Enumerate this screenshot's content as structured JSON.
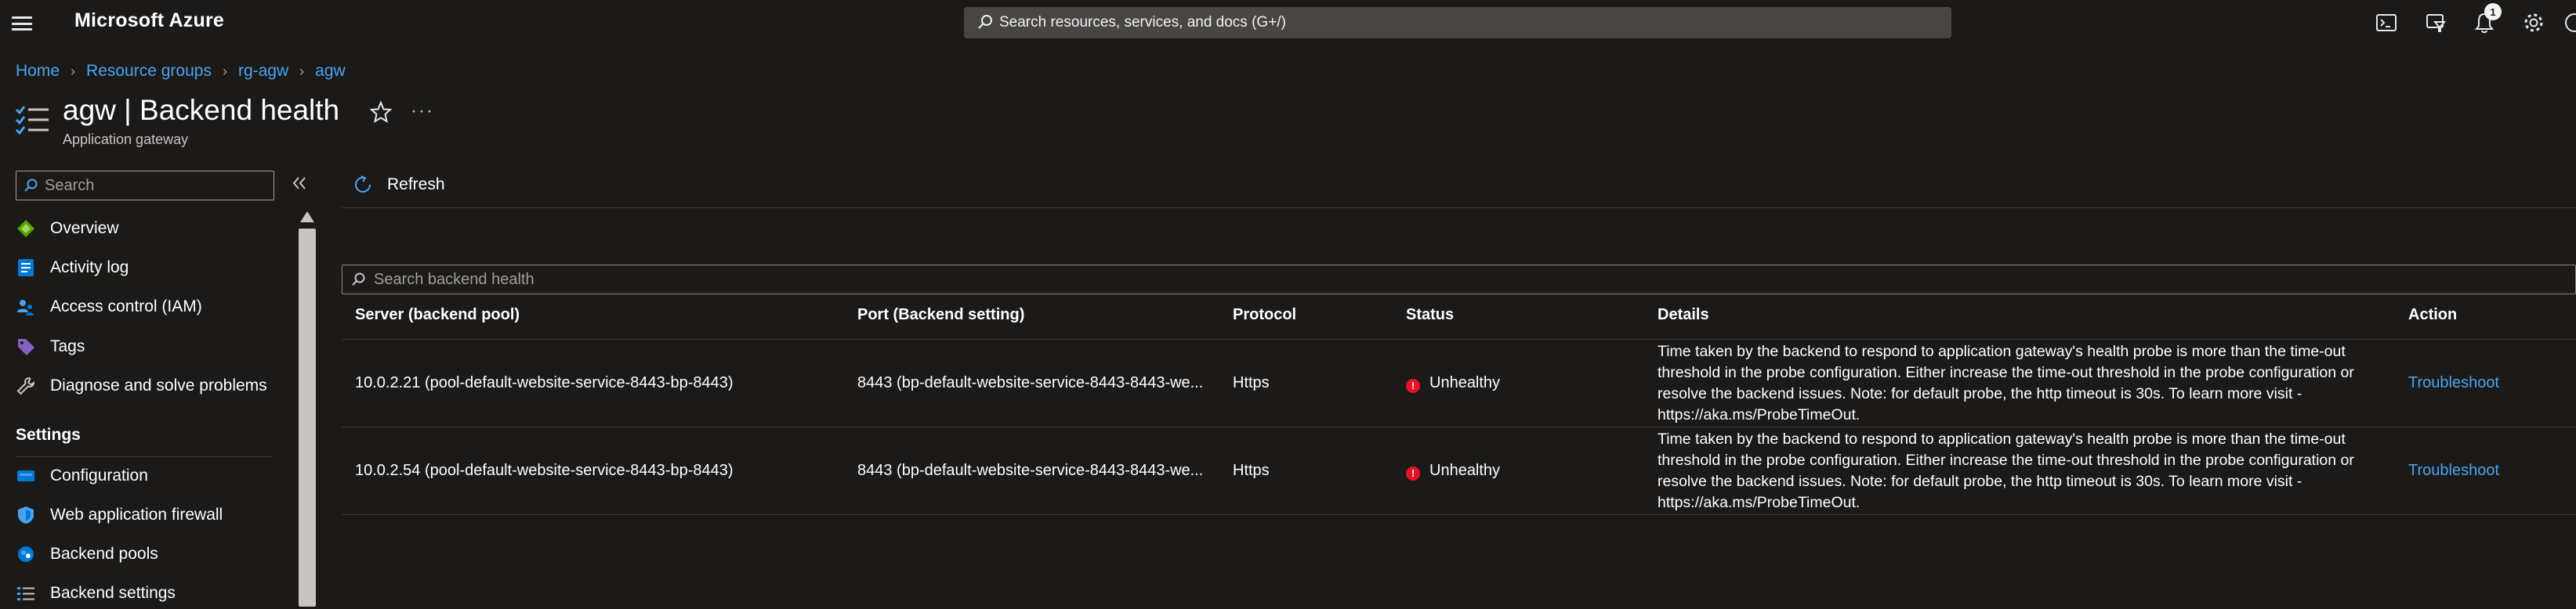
{
  "topbar": {
    "brand": "Microsoft Azure",
    "search_placeholder": "Search resources, services, and docs (G+/)",
    "notification_count": "1",
    "icons": [
      "cloud-shell-icon",
      "directory-filter-icon",
      "notifications-icon",
      "settings-icon"
    ]
  },
  "breadcrumb": [
    "Home",
    "Resource groups",
    "rg-agw",
    "agw"
  ],
  "page": {
    "title": "agw | Backend health",
    "subtitle": "Application gateway"
  },
  "nav": {
    "search_placeholder": "Search",
    "items": [
      {
        "label": "Overview",
        "icon": "overview-icon"
      },
      {
        "label": "Activity log",
        "icon": "activity-log-icon"
      },
      {
        "label": "Access control (IAM)",
        "icon": "iam-icon"
      },
      {
        "label": "Tags",
        "icon": "tag-icon"
      },
      {
        "label": "Diagnose and solve problems",
        "icon": "wrench-icon"
      }
    ],
    "settings_header": "Settings",
    "settings_items": [
      {
        "label": "Configuration",
        "icon": "configuration-icon"
      },
      {
        "label": "Web application firewall",
        "icon": "shield-icon"
      },
      {
        "label": "Backend pools",
        "icon": "backend-pools-icon"
      },
      {
        "label": "Backend settings",
        "icon": "backend-settings-icon"
      }
    ]
  },
  "toolbar": {
    "refresh_label": "Refresh"
  },
  "table": {
    "search_placeholder": "Search backend health",
    "columns": [
      "Server (backend pool)",
      "Port (Backend setting)",
      "Protocol",
      "Status",
      "Details",
      "Action"
    ],
    "rows": [
      {
        "server": "10.0.2.21 (pool-default-website-service-8443-bp-8443)",
        "port": "8443 (bp-default-website-service-8443-8443-we...",
        "protocol": "Https",
        "status": "Unhealthy",
        "details": "Time taken by the backend to respond to application gateway's health probe is more than the time-out threshold in the probe configuration. Either increase the time-out threshold in the probe configuration or resolve the backend issues. Note: for default probe, the http timeout is 30s. To learn more visit - https://aka.ms/ProbeTimeOut.",
        "action": "Troubleshoot"
      },
      {
        "server": "10.0.2.54 (pool-default-website-service-8443-bp-8443)",
        "port": "8443 (bp-default-website-service-8443-8443-we...",
        "protocol": "Https",
        "status": "Unhealthy",
        "details": "Time taken by the backend to respond to application gateway's health probe is more than the time-out threshold in the probe configuration. Either increase the time-out threshold in the probe configuration or resolve the backend issues. Note: for default probe, the http timeout is 30s. To learn more visit - https://aka.ms/ProbeTimeOut.",
        "action": "Troubleshoot"
      }
    ]
  },
  "colors": {
    "background": "#1b1a19",
    "link": "#4aa3f0",
    "error": "#e81123",
    "search_bar": "#484644"
  }
}
